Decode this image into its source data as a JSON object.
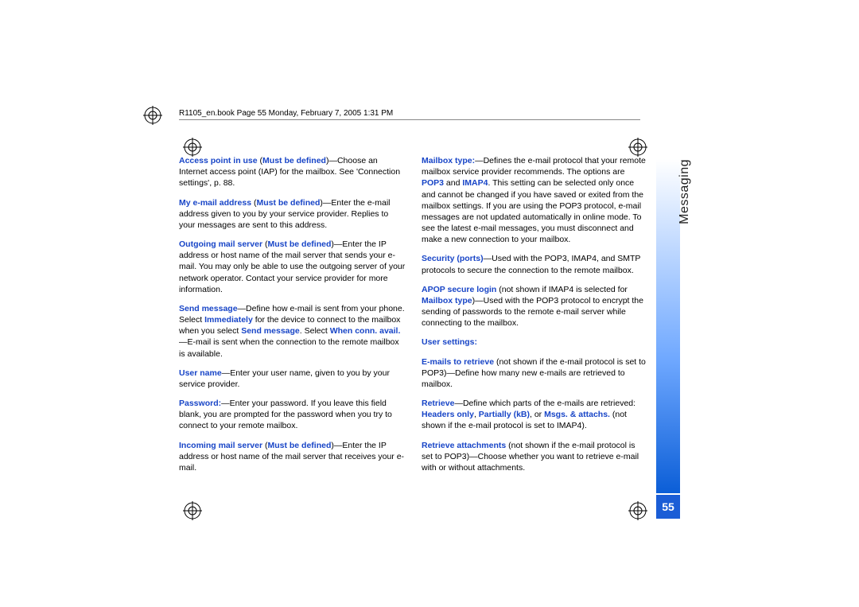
{
  "header": "R1105_en.book  Page 55  Monday, February 7, 2005  1:31 PM",
  "sideLabel": "Messaging",
  "pageNum": "55",
  "col1": {
    "p1a": "Access point in use",
    "p1b": " (",
    "p1c": "Must be defined",
    "p1d": ")—Choose an Internet access point (IAP) for the mailbox. See 'Connection settings', p. 88.",
    "p2a": "My e-mail address",
    "p2b": " (",
    "p2c": "Must be defined",
    "p2d": ")—Enter the e-mail address given to you by your service provider. Replies to your messages are sent to this address.",
    "p3a": "Outgoing mail server",
    "p3b": " (",
    "p3c": "Must be defined",
    "p3d": ")—Enter the IP address or host name of the mail server that sends your e-mail. You may only be able to use the outgoing server of your network operator. Contact your service provider for more information.",
    "p4a": "Send message",
    "p4b": "—Define how e-mail is sent from your phone. Select ",
    "p4c": "Immediately",
    "p4d": " for the device to connect to the mailbox when you select ",
    "p4e": "Send message",
    "p4f": ". Select ",
    "p4g": "When conn. avail.",
    "p4h": "—E-mail is sent when the connection to the remote mailbox is available.",
    "p5a": "User name",
    "p5b": "—Enter your user name, given to you by your service provider.",
    "p6a": "Password:",
    "p6b": "—Enter your password. If you leave this field blank, you are prompted for the password when you try to connect to your remote mailbox.",
    "p7a": "Incoming mail server",
    "p7b": " (",
    "p7c": "Must be defined",
    "p7d": ")—Enter the IP address or host name of the mail server that receives your e-mail."
  },
  "col2": {
    "p1a": "Mailbox type:",
    "p1b": "—Defines the e-mail protocol that your remote mailbox service provider recommends. The options are ",
    "p1c": "POP3",
    "p1d": " and ",
    "p1e": "IMAP4",
    "p1f": ". This setting can be selected only once and cannot be changed if you have saved or exited from the mailbox settings. If you are using the POP3 protocol, e-mail messages are not updated automatically in online mode. To see the latest e-mail messages, you must disconnect and make a new connection to your mailbox.",
    "p2a": "Security (ports)",
    "p2b": "—Used with the POP3, IMAP4, and SMTP protocols to secure the connection to the remote mailbox.",
    "p3a": "APOP secure login",
    "p3b": " (not shown if IMAP4 is selected for ",
    "p3c": "Mailbox type",
    "p3d": ")—Used with the POP3 protocol to encrypt the sending of passwords to the remote e-mail server while connecting to the mailbox.",
    "p4": "User settings:",
    "p5a": "E-mails to retrieve",
    "p5b": " (not shown if the e-mail protocol is set to POP3)—Define how many new e-mails are retrieved to mailbox.",
    "p6a": "Retrieve",
    "p6b": "—Define which parts of the e-mails are retrieved: ",
    "p6c": "Headers only",
    "p6d": ", ",
    "p6e": "Partially (kB)",
    "p6f": ", or ",
    "p6g": "Msgs. & attachs.",
    "p6h": " (not shown if the e-mail protocol is set to IMAP4).",
    "p7a": "Retrieve attachments",
    "p7b": " (not shown if the e-mail protocol is set to POP3)—Choose whether you want to retrieve e-mail with or without attachments."
  }
}
